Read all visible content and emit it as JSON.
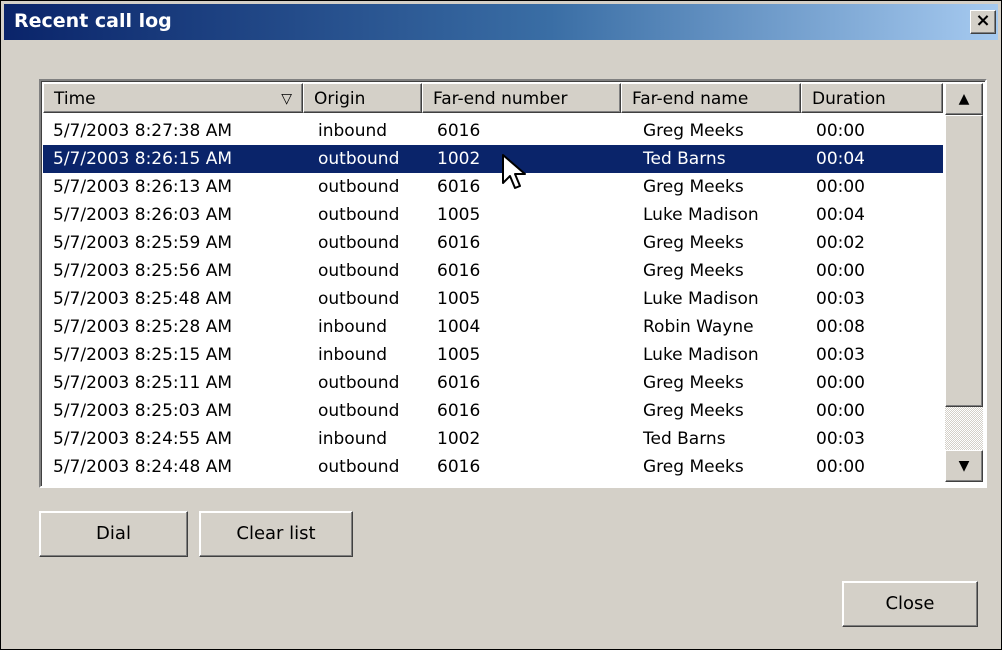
{
  "window": {
    "title": "Recent call log",
    "close_glyph": "×"
  },
  "columns": [
    {
      "label": "Time",
      "sort_indicator": "▽"
    },
    {
      "label": "Origin"
    },
    {
      "label": "Far-end number"
    },
    {
      "label": "Far-end name"
    },
    {
      "label": "Duration"
    }
  ],
  "rows": [
    {
      "time": "5/7/2003 8:27:38 AM",
      "origin": "inbound",
      "number": "6016",
      "name": "Greg Meeks",
      "duration": "00:00"
    },
    {
      "time": "5/7/2003 8:26:15 AM",
      "origin": "outbound",
      "number": "1002",
      "name": "Ted Barns",
      "duration": "00:04",
      "selected": true
    },
    {
      "time": "5/7/2003 8:26:13 AM",
      "origin": "outbound",
      "number": "6016",
      "name": "Greg Meeks",
      "duration": "00:00"
    },
    {
      "time": "5/7/2003 8:26:03 AM",
      "origin": "outbound",
      "number": "1005",
      "name": "Luke Madison",
      "duration": "00:04"
    },
    {
      "time": "5/7/2003 8:25:59 AM",
      "origin": "outbound",
      "number": "6016",
      "name": "Greg Meeks",
      "duration": "00:02"
    },
    {
      "time": "5/7/2003 8:25:56 AM",
      "origin": "outbound",
      "number": "6016",
      "name": "Greg Meeks",
      "duration": "00:00"
    },
    {
      "time": "5/7/2003 8:25:48 AM",
      "origin": "outbound",
      "number": "1005",
      "name": "Luke Madison",
      "duration": "00:03"
    },
    {
      "time": "5/7/2003 8:25:28 AM",
      "origin": "inbound",
      "number": "1004",
      "name": "Robin Wayne",
      "duration": "00:08"
    },
    {
      "time": "5/7/2003 8:25:15 AM",
      "origin": "inbound",
      "number": "1005",
      "name": "Luke Madison",
      "duration": "00:03"
    },
    {
      "time": "5/7/2003 8:25:11 AM",
      "origin": "outbound",
      "number": "6016",
      "name": "Greg Meeks",
      "duration": "00:00"
    },
    {
      "time": "5/7/2003 8:25:03 AM",
      "origin": "outbound",
      "number": "6016",
      "name": "Greg Meeks",
      "duration": "00:00"
    },
    {
      "time": "5/7/2003 8:24:55 AM",
      "origin": "inbound",
      "number": "1002",
      "name": "Ted Barns",
      "duration": "00:03"
    },
    {
      "time": "5/7/2003 8:24:48 AM",
      "origin": "outbound",
      "number": "6016",
      "name": "Greg Meeks",
      "duration": "00:00"
    }
  ],
  "scrollbar": {
    "up_glyph": "▲",
    "down_glyph": "▼"
  },
  "buttons": {
    "dial": "Dial",
    "clear_list": "Clear list",
    "close": "Close"
  },
  "colors": {
    "selection": "#0a246a",
    "face": "#d4d0c8"
  }
}
